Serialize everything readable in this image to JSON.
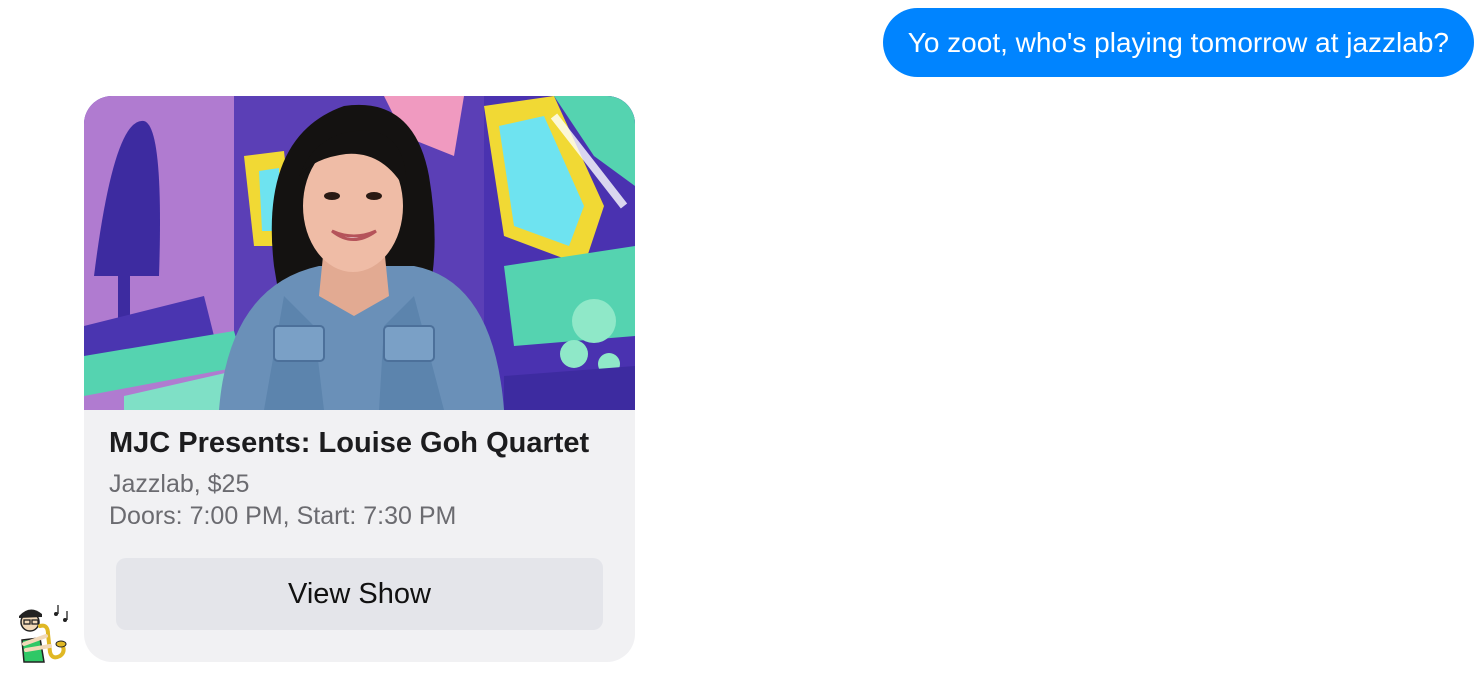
{
  "conversation": {
    "user_message": {
      "text": "Yo zoot, who's playing tomorrow at jazzlab?",
      "bubble_color": "#0084ff"
    },
    "bot_card": {
      "image_icon": "musician-photo",
      "title": "MJC Presents: Louise Goh Quartet",
      "subtitle_line1": "Jazzlab, $25",
      "subtitle_line2": "Doors: 7:00 PM, Start: 7:30 PM",
      "button_label": "View Show"
    },
    "bot_avatar_icon": "saxophone-player-icon"
  }
}
